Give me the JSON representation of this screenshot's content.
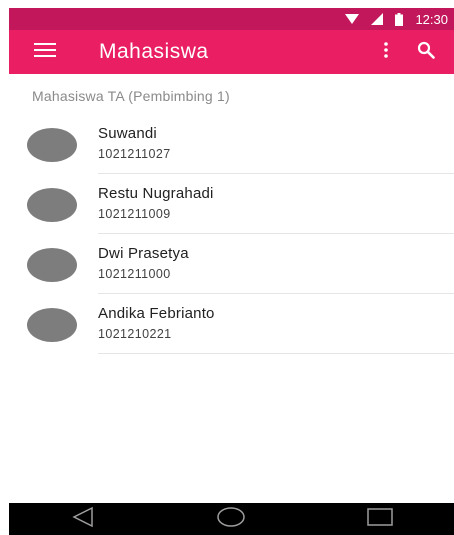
{
  "status_bar": {
    "time": "12:30",
    "icons": [
      "wifi-icon",
      "signal-icon",
      "battery-icon"
    ]
  },
  "app_bar": {
    "title": "Mahasiswa",
    "menu_icon": "hamburger-menu-icon",
    "overflow_icon": "more-vert-icon",
    "search_icon": "search-icon"
  },
  "subheader": "Mahasiswa TA (Pembimbing 1)",
  "students": [
    {
      "name": "Suwandi",
      "nim": "1021211027"
    },
    {
      "name": "Restu Nugrahadi",
      "nim": "1021211009"
    },
    {
      "name": "Dwi Prasetya",
      "nim": "1021211000"
    },
    {
      "name": "Andika Febrianto",
      "nim": "1021210221"
    }
  ],
  "nav_bar": {
    "icons": [
      "back-icon",
      "home-icon",
      "recents-icon"
    ]
  },
  "colors": {
    "status_bar": "#c2185b",
    "app_bar": "#e91e63",
    "avatar": "#7d7d7d"
  }
}
